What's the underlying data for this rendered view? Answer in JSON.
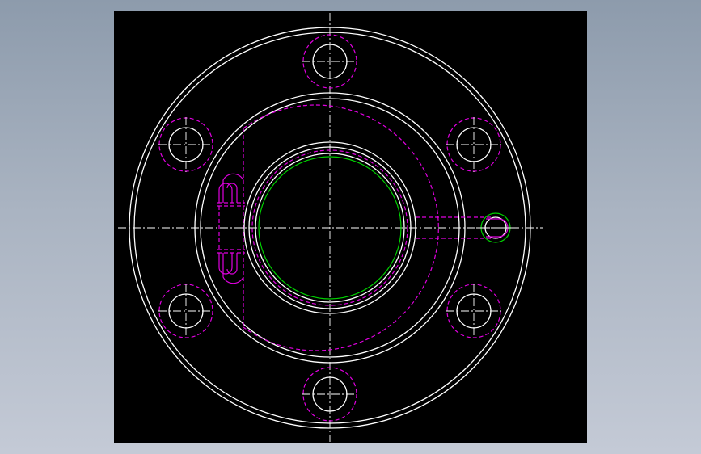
{
  "viewport": {
    "background": "#000000",
    "surround": [
      "#8d9bac",
      "#c4cad6"
    ]
  },
  "colors": {
    "outline": "#ffffff",
    "hidden": "#e000e0",
    "bore": "#00d000",
    "centerline": "#ffffff"
  },
  "drawing": {
    "view": "flange-front-view",
    "bolt_holes": 6,
    "lube_port": 1,
    "line_types": [
      "solid-outline",
      "dashed-hidden",
      "dash-dot-centerline"
    ]
  }
}
